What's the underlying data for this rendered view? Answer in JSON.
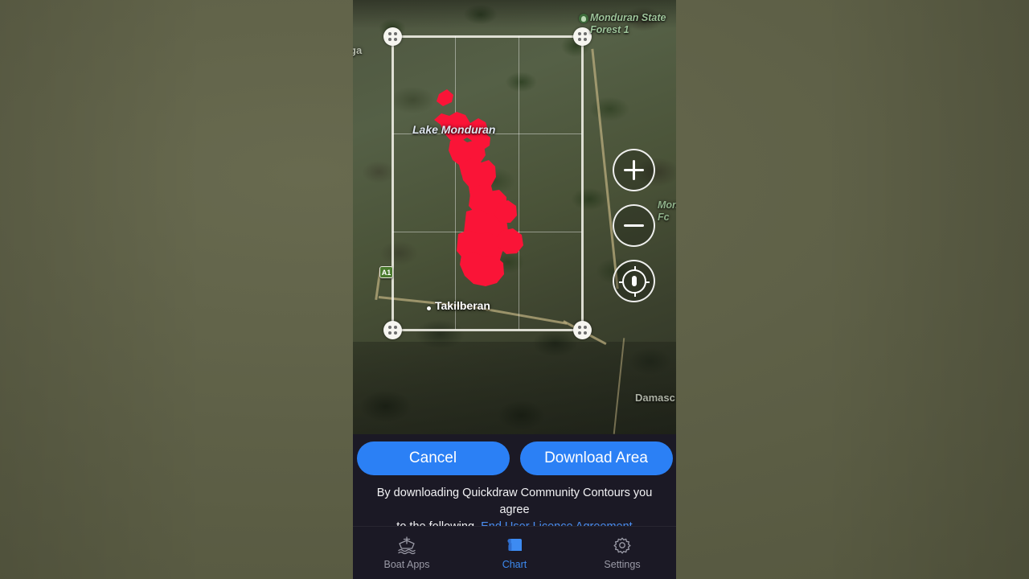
{
  "app": {
    "accent_blue": "#2b80f5",
    "link_blue": "#4a8df0",
    "panel_bg": "#1b1925",
    "background_blur": "#5f6148",
    "selection_stroke": "#f3f1e8",
    "contour_red": "#fa1437"
  },
  "map": {
    "labels": [
      {
        "name": "lake-monduran-label",
        "text": "Lake Monduran",
        "kind": "water"
      },
      {
        "name": "takilberan-label",
        "text": "Takilberan",
        "kind": "town"
      },
      {
        "name": "monduran-state-forest-label-line1",
        "text": "Monduran State",
        "kind": "park"
      },
      {
        "name": "monduran-state-forest-label-line2",
        "text": "Forest 1",
        "kind": "park"
      },
      {
        "name": "monduran-state-forest-label-2",
        "text": "Mond",
        "kind": "park"
      },
      {
        "name": "monduran-state-forest-label-2b",
        "text": "Fc",
        "kind": "park"
      },
      {
        "name": "damascus-label",
        "text": "Damasc",
        "kind": "town"
      },
      {
        "name": "clipped-left-label",
        "text": "ga",
        "kind": "town"
      }
    ],
    "highway_shield": "A1",
    "controls": {
      "zoom_in": "+",
      "zoom_out": "−",
      "locate": "locate-me"
    },
    "selection": {
      "handles": [
        "top-left",
        "top-right",
        "bottom-left",
        "bottom-right"
      ],
      "grid_columns": 3,
      "grid_rows": 3
    }
  },
  "panel": {
    "cancel_label": "Cancel",
    "download_label": "Download Area",
    "legal_text_1": "By downloading Quickdraw Community Contours you agree",
    "legal_text_2": "to the following.",
    "legal_link": "End User Licence Agreement"
  },
  "tabbar": {
    "tabs": [
      {
        "label": "Boat Apps",
        "icon": "boat-icon",
        "active": false
      },
      {
        "label": "Chart",
        "icon": "chart-icon",
        "active": true
      },
      {
        "label": "Settings",
        "icon": "gear-icon",
        "active": false
      }
    ]
  }
}
